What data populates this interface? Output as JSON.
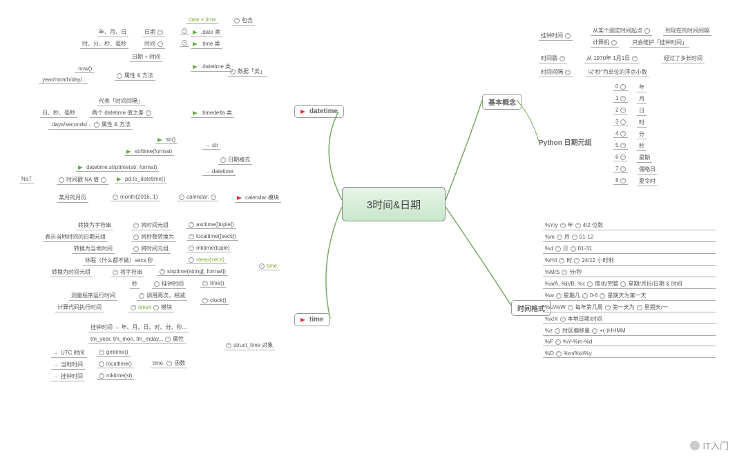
{
  "center": "3时间&日期",
  "branches": {
    "datetime": "datetime",
    "time": "time",
    "concepts": "基本概念",
    "datetuple": "Python 日期元组",
    "format": "时间格式"
  },
  "dt": {
    "contain": "包含",
    "datetime_plus": "date + time",
    "date_cls": ".date 类",
    "time_cls": ".time 类",
    "datetime_cls": ".datetime 类",
    "timedelta_cls": ".timedelta 类",
    "date_lbl": "日期",
    "time_lbl": "时间",
    "datetime_lbl": "日期 + 时间",
    "ymd": "年、月、日",
    "hms": "时、分、秒、毫秒",
    "now": ".now()",
    "ymd_attr": ".year/month/day/...",
    "attrs": "属性 & 方法",
    "delta_repr": "代表「时间间隔」",
    "delta_diff": "两个 datetime 值之差",
    "delta_attrs": ".days/seconds/...",
    "dhms": "日、秒、毫秒",
    "data_cls": "数据「类」",
    "datefmt": "日期格式",
    "to_str": "str",
    "to_dt": "datetime",
    "str_fn": "str()",
    "strftime": "strftime(format)",
    "strptime": "datetime.strptime(str, format)",
    "pdto": "pd.to_datetime()",
    "nat": "NaT",
    "na": "时间戳 NA 值",
    "cal": "calendar 模块",
    "calmod": "calendar.",
    "month": "month(2016, 1)",
    "monthcal": "某月的月历"
  },
  "tm": {
    "timemod": "time.",
    "asctime": "asctime([tuple])",
    "asctime_l1": "转换为字符串",
    "asctime_l2": "将时间元组",
    "localtime": "localtime([secs])",
    "localtime_l1": "表示当地时间的日期元组",
    "localtime_l2": "将秒数转换为",
    "mktime": "mktime(tuple)",
    "mktime_l1": "转换为当地时间",
    "mktime_l2": "将时间元组",
    "sleep": "sleep(secs)",
    "sleep_l": "休眠（什么都不做）secs 秒",
    "strptime": "strptime(string[, format])",
    "strptime_l1": "转换为时间元组",
    "strptime_l2": "将字符串",
    "timefn": "time()",
    "time_l1": "秒",
    "time_l2": "挂钟时间",
    "clock": "clock()",
    "clock_l1": "测量程序运行时间",
    "clock_l2": "调用两次，相减",
    "timeit": "timeit",
    "timeit_l": "计算代码执行时间",
    "module": "模块",
    "struct": "struct_time 对象",
    "struct_l1": "挂钟时间 → 年、月、日、时、分、秒...",
    "tm_attrs": "tm_year, tm_mon, tm_mday...",
    "attrs": "属性",
    "func": "函数",
    "gmtime": "gmtime()",
    "utc": "UTC 时间",
    "localtime2": "localtime()",
    "local": "当地时间",
    "mktime2": "mktime(st)",
    "wallclock": "挂钟时间",
    "timedot": "time."
  },
  "cp": {
    "wallclock": "挂钟时间",
    "wc1": "从某个固定时间起点",
    "wc2": "到现在的时间间隔",
    "wc3": "计算机",
    "wc4": "只会维护「挂钟时间」",
    "timestamp": "时间戳",
    "ts1": "从 1970年 1月1日",
    "ts2": "经过了多长时间",
    "interval": "时间间隔",
    "iv1": "以\"秒\"为单位的浮点小数"
  },
  "tup": {
    "h": [
      "0",
      "1",
      "2",
      "3",
      "4",
      "5",
      "6",
      "7",
      "8"
    ],
    "v": [
      "年",
      "月",
      "日",
      "时",
      "分",
      "秒",
      "星期",
      "儒略日",
      "夏令时"
    ]
  },
  "fmt": {
    "rows": [
      {
        "c": "%Y/y",
        "d": "年",
        "e": "4/2 位数"
      },
      {
        "c": "%m",
        "d": "月",
        "e": "01-12"
      },
      {
        "c": "%d",
        "d": "日",
        "e": "01-31"
      },
      {
        "c": "%H/I",
        "d": "时",
        "e": "24/12 小时制"
      },
      {
        "c": "%M/S",
        "d": "分/秒",
        "e": ""
      },
      {
        "c": "%a/A, %b/B, %c",
        "d": "简化/完整",
        "e": "星期/月份/日期 & 时间"
      },
      {
        "c": "%w",
        "d": "星期几",
        "e": "0-6",
        "f": "星期天为第一天"
      },
      {
        "c": "%U/%W",
        "d": "每年第几周",
        "e": "第一天为",
        "f": "星期天/一"
      },
      {
        "c": "%x/X",
        "d": "本地日期/时间",
        "e": ""
      },
      {
        "c": "%z",
        "d": "时区偏移量",
        "e": "+(-)HHMM"
      },
      {
        "c": "%F",
        "d": "%Y-%m-%d",
        "e": ""
      },
      {
        "c": "%D",
        "d": "%m/%d/%y",
        "e": ""
      }
    ]
  },
  "watermark": "IT入门"
}
